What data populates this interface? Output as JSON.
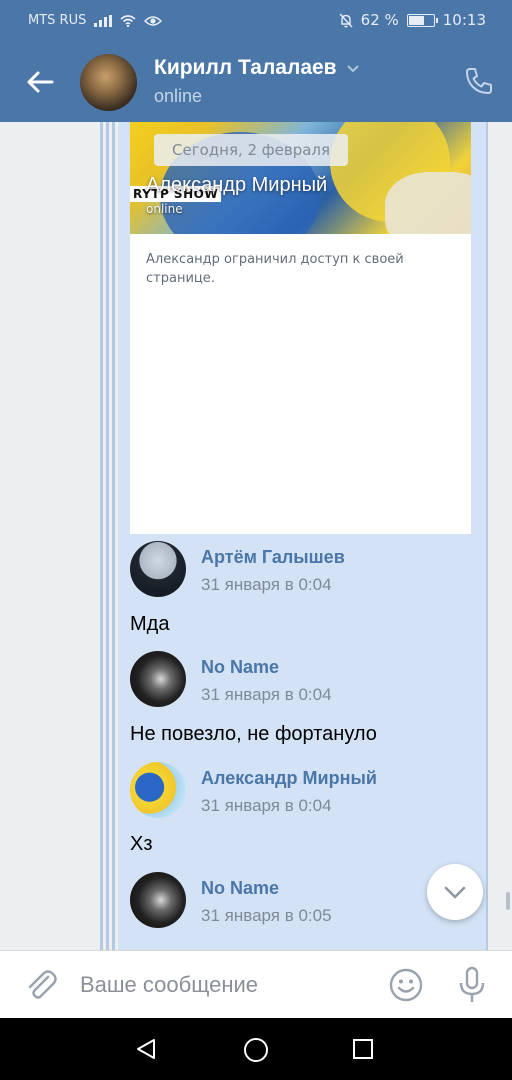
{
  "status_bar": {
    "carrier": "MTS RUS",
    "battery": "62 %",
    "battery_level": 0.62,
    "time": "10:13",
    "icons": [
      "signal-icon",
      "wifi-icon",
      "eye-icon",
      "bell-off-icon",
      "battery-icon"
    ]
  },
  "header": {
    "name": "Кирилл Талалаев",
    "status": "online",
    "icons": [
      "back-arrow-icon",
      "chevron-down-icon",
      "phone-icon"
    ]
  },
  "forwarded_card": {
    "date_pill": "Сегодня, 2 февраля",
    "cover_tag": "RYTP SHOW",
    "name": "Александр Мирный",
    "online": "online",
    "restricted_text": "Александр ограничил доступ к своей странице."
  },
  "messages": [
    {
      "author": "Артём Галышев",
      "time": "31 января в 0:04",
      "text": "Мда"
    },
    {
      "author": "No Name",
      "time": "31 января в 0:04",
      "text": "Не повезло, не фортануло"
    },
    {
      "author": "Александр Мирный",
      "time": "31 января в 0:04",
      "text": "Хз"
    },
    {
      "author": "No Name",
      "time": "31 января в 0:05",
      "text": ""
    }
  ],
  "composer": {
    "placeholder": "Ваше сообщение",
    "icons": [
      "paperclip-icon",
      "smile-icon",
      "microphone-icon"
    ]
  },
  "colors": {
    "brand": "#4a76a8",
    "forward_bg": "#d3e2f5",
    "author": "#4a76a8"
  }
}
